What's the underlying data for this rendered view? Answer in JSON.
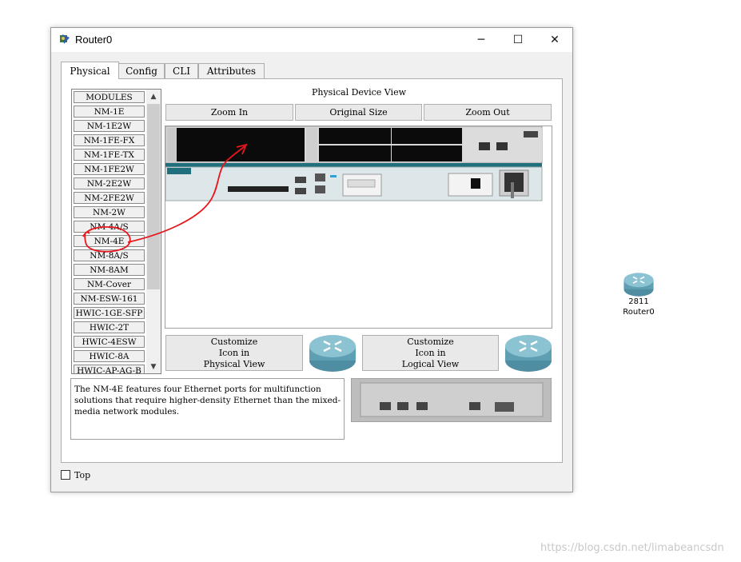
{
  "window": {
    "title": "Router0",
    "controls": {
      "minimize": "─",
      "maximize": "☐",
      "close": "✕"
    }
  },
  "tabs": [
    {
      "label": "Physical",
      "active": true
    },
    {
      "label": "Config"
    },
    {
      "label": "CLI"
    },
    {
      "label": "Attributes"
    }
  ],
  "modules": {
    "items": [
      "MODULES",
      "NM-1E",
      "NM-1E2W",
      "NM-1FE-FX",
      "NM-1FE-TX",
      "NM-1FE2W",
      "NM-2E2W",
      "NM-2FE2W",
      "NM-2W",
      "NM-4A/S",
      "NM-4E",
      "NM-8A/S",
      "NM-8AM",
      "NM-Cover",
      "NM-ESW-161",
      "HWIC-1GE-SFP",
      "HWIC-2T",
      "HWIC-4ESW",
      "HWIC-8A",
      "HWIC-AP-AG-B"
    ],
    "selected": "NM-4E",
    "scroll_up": "▲",
    "scroll_down": "▼"
  },
  "physical_view": {
    "title": "Physical Device View",
    "zoom_in": "Zoom In",
    "original_size": "Original Size",
    "zoom_out": "Zoom Out"
  },
  "customize": {
    "physical": [
      "Customize",
      "Icon in",
      "Physical View"
    ],
    "logical": [
      "Customize",
      "Icon in",
      "Logical View"
    ]
  },
  "description": "The NM-4E features four Ethernet ports for multifunction solutions that require higher-density Ethernet than the mixed-media network modules.",
  "top_label": "Top",
  "desktop_device": {
    "model": "2811",
    "name": "Router0"
  },
  "watermark": "https://blog.csdn.net/limabeancsdn",
  "colors": {
    "annotation": "#e8151b",
    "router_blue": "#5f9fb3",
    "chassis_teal": "#1f6f7d"
  }
}
